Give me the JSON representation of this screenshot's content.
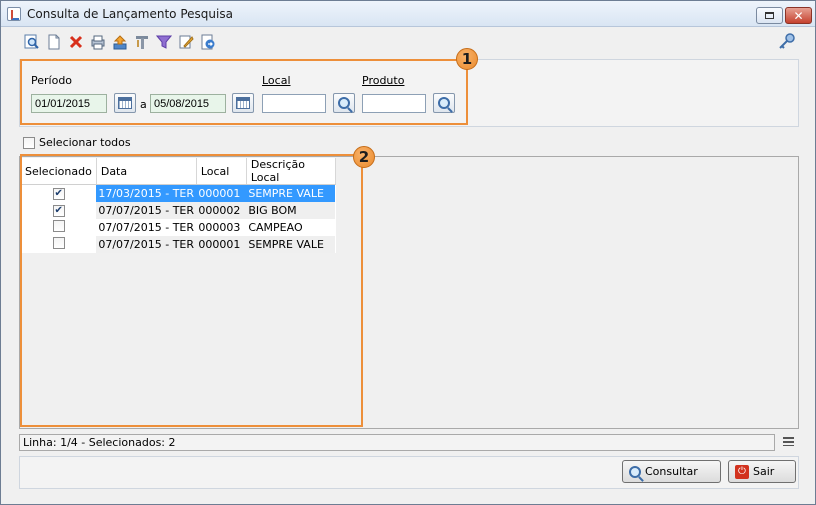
{
  "window": {
    "title": "Consulta de Lançamento Pesquisa",
    "close_glyph": "✕"
  },
  "toolbar": {
    "icons": [
      "search-doc-icon",
      "new-doc-icon",
      "delete-icon",
      "print-icon",
      "upload-icon",
      "tools-icon",
      "filter-icon",
      "edit-icon",
      "export-icon"
    ],
    "key_icon": "key-icon"
  },
  "filters": {
    "badge": "1",
    "periodo_label": "Período",
    "date_start": "01/01/2015",
    "date_sep": "a",
    "date_end": "05/08/2015",
    "local_label": "Local",
    "local_value": "",
    "produto_label": "Produto",
    "produto_value": ""
  },
  "select_all": {
    "label": "Selecionar todos",
    "checked": false
  },
  "grid": {
    "badge": "2",
    "columns": [
      "Selecionado",
      "Data",
      "Local",
      "Descrição Local"
    ],
    "rows": [
      {
        "selected": true,
        "data": "17/03/2015 - TER",
        "local": "000001",
        "descricao": "SEMPRE VALE"
      },
      {
        "selected": true,
        "data": "07/07/2015 - TER",
        "local": "000002",
        "descricao": "BIG BOM"
      },
      {
        "selected": false,
        "data": "07/07/2015 - TER",
        "local": "000003",
        "descricao": "CAMPEAO"
      },
      {
        "selected": false,
        "data": "07/07/2015 - TER",
        "local": "000001",
        "descricao": "SEMPRE VALE"
      }
    ]
  },
  "status": {
    "text": "Linha: 1/4 - Selecionados: 2"
  },
  "actions": {
    "consultar": "Consultar",
    "sair": "Sair"
  },
  "colors": {
    "accent_orange": "#ed8f3a",
    "row_highlight": "#3399ff",
    "date_bg": "#e8f5ea"
  }
}
